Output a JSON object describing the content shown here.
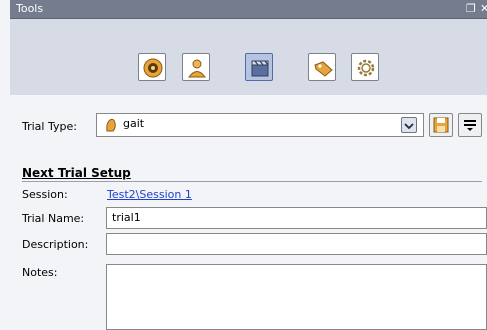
{
  "window": {
    "title": "Tools"
  },
  "toolbar": {
    "buttons": [
      {
        "icon": "camera-lens-icon"
      },
      {
        "icon": "person-icon"
      },
      {
        "icon": "clapperboard-icon"
      },
      {
        "icon": "tag-icon"
      },
      {
        "icon": "gear-icon"
      }
    ]
  },
  "trial_type": {
    "label": "Trial Type:",
    "value": "gait"
  },
  "section": {
    "title": "Next Trial Setup"
  },
  "session": {
    "label": "Session:",
    "value": "Test2\\Session 1"
  },
  "trial_name": {
    "label": "Trial Name:",
    "value": "trial1"
  },
  "description": {
    "label": "Description:",
    "value": ""
  },
  "notes": {
    "label": "Notes:",
    "value": ""
  },
  "colors": {
    "title_bar": "#747c8e",
    "toolbar": "#d6dbe6",
    "panel": "#f3f4f7",
    "link": "#1f3fcc",
    "active_tool": "#b6c4e0"
  }
}
